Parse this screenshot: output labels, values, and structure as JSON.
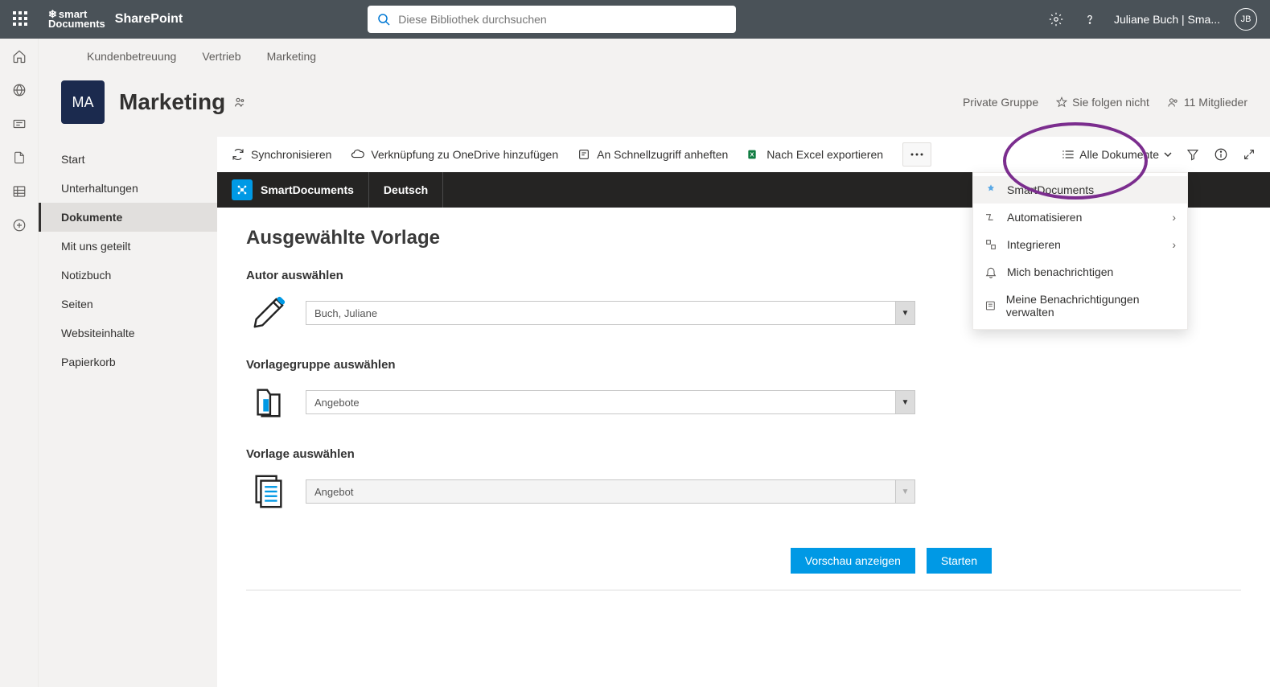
{
  "header": {
    "app_name": "SharePoint",
    "logo_top": "smart",
    "logo_bottom": "Documents",
    "search_placeholder": "Diese Bibliothek durchsuchen",
    "user_display": "Juliane Buch | Sma...",
    "user_initials": "JB"
  },
  "hubnav": {
    "items": [
      "Kundenbetreuung",
      "Vertrieb",
      "Marketing"
    ]
  },
  "site": {
    "tile": "MA",
    "title": "Marketing",
    "privacy": "Private Gruppe",
    "follow": "Sie folgen nicht",
    "members": "11 Mitglieder"
  },
  "leftnav": {
    "items": [
      "Start",
      "Unterhaltungen",
      "Dokumente",
      "Mit uns geteilt",
      "Notizbuch",
      "Seiten",
      "Websiteinhalte",
      "Papierkorb"
    ],
    "active_index": 2
  },
  "commandbar": {
    "sync": "Synchronisieren",
    "onedrive": "Verknüpfung zu OneDrive hinzufügen",
    "pin": "An Schnellzugriff anheften",
    "excel": "Nach Excel exportieren",
    "view": "Alle Dokumente"
  },
  "dropdown": {
    "items": [
      "SmartDocuments",
      "Automatisieren",
      "Integrieren",
      "Mich benachrichtigen",
      "Meine Benachrichtigungen verwalten"
    ]
  },
  "breadcrumb": {
    "root": "SmartDocuments",
    "path": "Deutsch"
  },
  "form": {
    "title": "Ausgewählte Vorlage",
    "author_label": "Autor auswählen",
    "author_value": "Buch, Juliane",
    "group_label": "Vorlagegruppe auswählen",
    "group_value": "Angebote",
    "template_label": "Vorlage auswählen",
    "template_value": "Angebot",
    "preview": "Vorschau anzeigen",
    "start": "Starten"
  }
}
